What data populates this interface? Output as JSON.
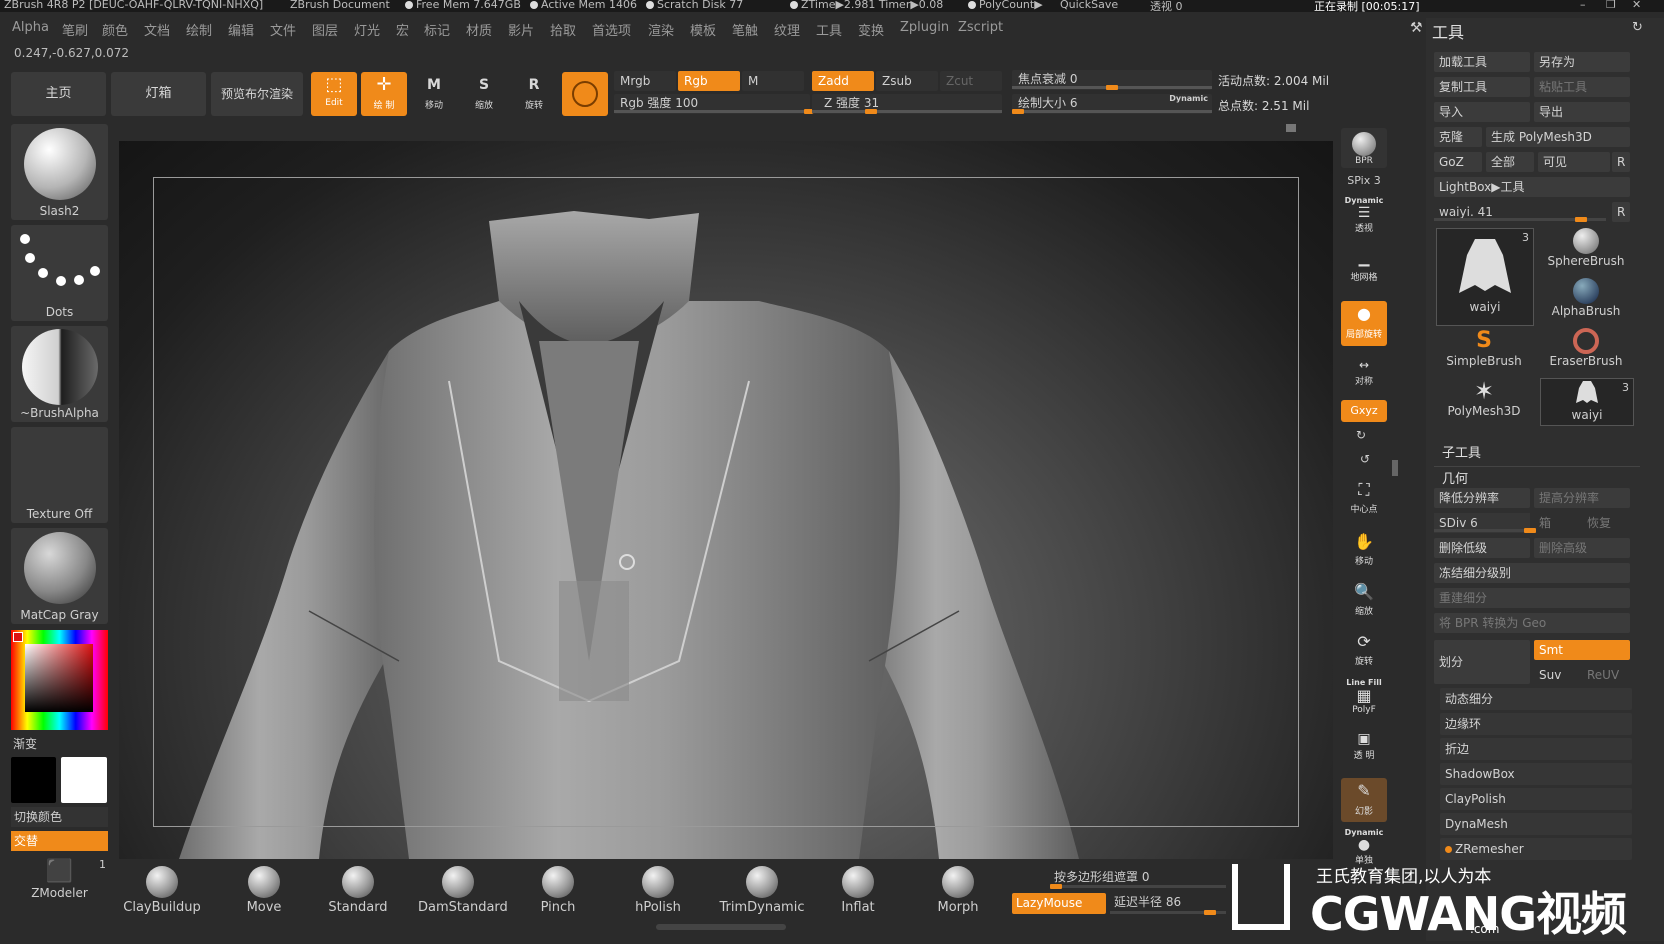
{
  "titlebar": {
    "app": "ZBrush 4R8 P2 [DEUC-OAHF-QLRV-TQNI-NHXQ]",
    "doc": "ZBrush Document",
    "free_mem": "Free Mem 7.647GB",
    "active_mem": "Active Mem 1406",
    "scratch": "Scratch Disk 77",
    "ztime": "ZTime▶2.981 Timer▶0.08",
    "polycount": "PolyCount▶",
    "quicksave": "QuickSave",
    "perspective": "透视 0",
    "recording": "正在录制 [00:05:17]"
  },
  "menu": [
    "Alpha",
    "笔刷",
    "颜色",
    "文档",
    "绘制",
    "编辑",
    "文件",
    "图层",
    "灯光",
    "宏",
    "标记",
    "材质",
    "影片",
    "拾取",
    "首选项",
    "渲染",
    "模板",
    "笔触",
    "纹理",
    "工具",
    "变换",
    "Zplugin",
    "Zscript"
  ],
  "coords": "0.247,-0.627,0.072",
  "toolbar": {
    "home": "主页",
    "lightbox": "灯箱",
    "preview_bool": "预览布尔渲染",
    "edit": "Edit",
    "draw": "绘 制",
    "move": "移动",
    "scale": "缩放",
    "rotate": "旋转",
    "mrgb": "Mrgb",
    "rgb": "Rgb",
    "m": "M",
    "rgb_intensity_label": "Rgb 强度 100",
    "rgb_intensity": 100,
    "zadd": "Zadd",
    "zsub": "Zsub",
    "zcut": "Zcut",
    "z_intensity_label": "Z 强度 31",
    "z_intensity": 31,
    "focal_label": "焦点衰减 0",
    "focal": 0,
    "draw_size_label": "绘制大小 6",
    "draw_size": 6,
    "dynamic": "Dynamic",
    "active_points": "活动点数: 2.004 Mil",
    "total_points": "总点数: 2.51 Mil"
  },
  "left": {
    "brush": "Slash2",
    "stroke": "Dots",
    "alpha": "~BrushAlpha",
    "texture": "Texture Off",
    "material": "MatCap Gray",
    "gradient": "渐变",
    "switch_color": "切换颜色",
    "alternate": "交替",
    "zmodeler": "ZModeler",
    "zmodeler_count": "1"
  },
  "shelf": {
    "bpr": "BPR",
    "spix": "SPix 3",
    "dynamic": "Dynamic",
    "persp": "透视",
    "floor": "地网格",
    "local": "局部旋转",
    "sym": "对称",
    "xyz": "Gxyz",
    "frame": "中心点",
    "move": "移动",
    "zoom": "缩放",
    "rotate": "旋转",
    "linefill": "Line Fill",
    "polyf": "PolyF",
    "transp": "透 明",
    "ghost": "幻影",
    "dynamic2": "Dynamic",
    "solo": "单独"
  },
  "tool": {
    "header": "工具",
    "load": "加载工具",
    "saveas": "另存为",
    "copy": "复制工具",
    "paste": "粘贴工具",
    "import": "导入",
    "export": "导出",
    "clone": "克隆",
    "make_poly": "生成 PolyMesh3D",
    "goz": "GoZ",
    "all": "全部",
    "visible": "可见",
    "r": "R",
    "lightbox_tool": "LightBox▶工具",
    "current_label": "waiyi. 41",
    "current": 41,
    "thumbs": [
      {
        "name": "waiyi",
        "count": "3"
      },
      {
        "name": "SphereBrush",
        "count": ""
      },
      {
        "name": "AlphaBrush",
        "count": ""
      },
      {
        "name": "SimpleBrush",
        "count": ""
      },
      {
        "name": "EraserBrush",
        "count": ""
      },
      {
        "name": "PolyMesh3D",
        "count": ""
      },
      {
        "name": "waiyi",
        "count": "3"
      }
    ],
    "subtool": "子工具",
    "geometry": "几何",
    "lower_res": "降低分辨率",
    "higher_res": "提高分辨率",
    "sdiv_label": "SDiv 6",
    "sdiv": 6,
    "cage": "箱",
    "rstr": "恢复",
    "del_lower": "删除低级",
    "del_higher": "删除高级",
    "freeze": "冻结细分级别",
    "reconstruct": "重建细分",
    "bpr_geo": "将 BPR 转换为 Geo",
    "divide": "划分",
    "smt": "Smt",
    "suv": "Suv",
    "reuv": "ReUV",
    "dynamic_sub": "动态细分",
    "edgeloop": "边缘环",
    "crease": "折边",
    "shadowbox": "ShadowBox",
    "claypolish": "ClayPolish",
    "dynamesh": "DynaMesh",
    "zremesher": "ZRemesher"
  },
  "bottom": {
    "brushes": [
      "ClayBuildup",
      "Move",
      "Standard",
      "DamStandard",
      "Pinch",
      "hPolish",
      "TrimDynamic",
      "Inflat",
      "Morph"
    ],
    "polygroup_mask_label": "按多边形组遮罩 0",
    "polygroup_mask": 0,
    "lazymouse": "LazyMouse",
    "lazy_radius_label": "延迟半径 86",
    "lazy_radius": 86
  },
  "watermark": {
    "slogan": "王氏教育集团,以人为本",
    "brand": "CGWANG视频",
    "domain": ".com"
  },
  "colors": {
    "accent": "#f08a1a",
    "panel": "#2f2f2f",
    "canvas": "#1a1a1a"
  }
}
